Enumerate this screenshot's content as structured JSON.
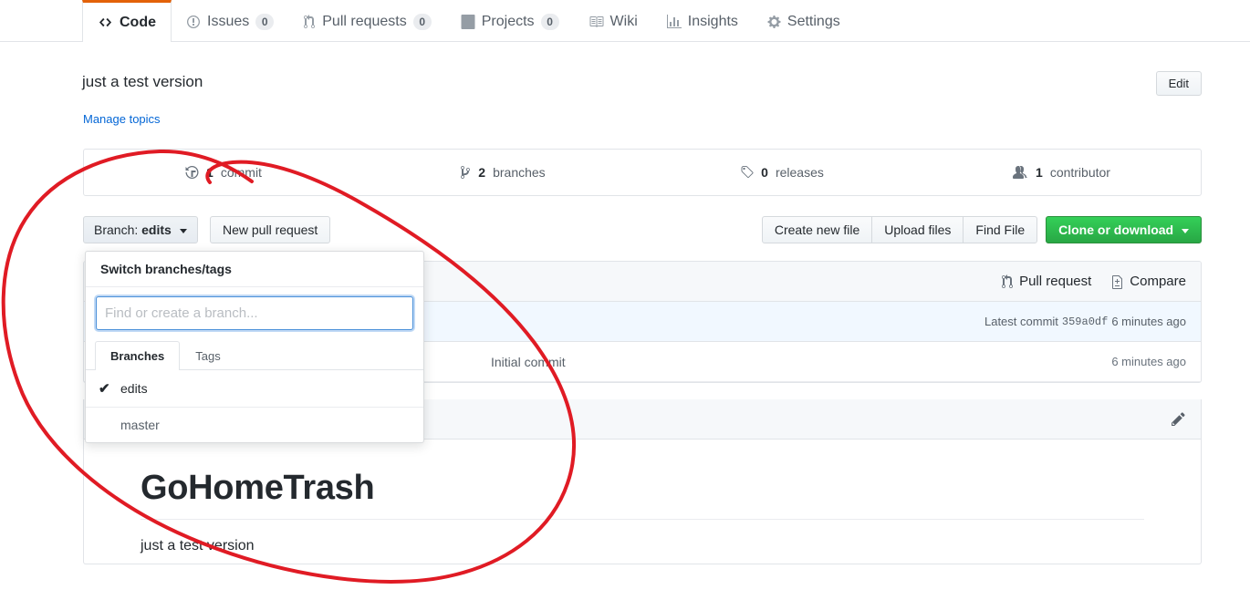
{
  "nav": {
    "tabs": [
      {
        "label": "Code",
        "icon": "code-icon",
        "count": null,
        "active": true
      },
      {
        "label": "Issues",
        "icon": "issue-opened-icon",
        "count": "0",
        "active": false
      },
      {
        "label": "Pull requests",
        "icon": "git-pull-request-icon",
        "count": "0",
        "active": false
      },
      {
        "label": "Projects",
        "icon": "project-board-icon",
        "count": "0",
        "active": false
      },
      {
        "label": "Wiki",
        "icon": "book-icon",
        "count": null,
        "active": false
      },
      {
        "label": "Insights",
        "icon": "graph-icon",
        "count": null,
        "active": false
      },
      {
        "label": "Settings",
        "icon": "gear-icon",
        "count": null,
        "active": false
      }
    ]
  },
  "repo": {
    "description": "just a test version",
    "manage_topics_label": "Manage topics",
    "edit_label": "Edit"
  },
  "stats": [
    {
      "num": "1",
      "label": "commit",
      "icon": "history-icon"
    },
    {
      "num": "2",
      "label": "branches",
      "icon": "git-branch-icon"
    },
    {
      "num": "0",
      "label": "releases",
      "icon": "tag-icon"
    },
    {
      "num": "1",
      "label": "contributor",
      "icon": "people-icon"
    }
  ],
  "actions": {
    "branch_prefix": "Branch:",
    "branch_current": "edits",
    "new_pull_request": "New pull request",
    "create_new_file": "Create new file",
    "upload_files": "Upload files",
    "find_file": "Find File",
    "clone_or_download": "Clone or download"
  },
  "commit_box": {
    "pull_request_label": "Pull request",
    "compare_label": "Compare",
    "latest_prefix": "Latest commit",
    "latest_sha": "359a0df",
    "latest_time": "6 minutes ago",
    "rows": [
      {
        "name": "",
        "message": "Initial commit",
        "time": "6 minutes ago"
      }
    ]
  },
  "readme": {
    "header_label": "",
    "title": "GoHomeTrash",
    "body": "just a test version",
    "edit_icon": "pencil-icon"
  },
  "dropdown": {
    "title": "Switch branches/tags",
    "search_placeholder": "Find or create a branch...",
    "search_value": "",
    "tabs": [
      {
        "label": "Branches",
        "active": true
      },
      {
        "label": "Tags",
        "active": false
      }
    ],
    "items": [
      {
        "name": "edits",
        "selected": true
      },
      {
        "name": "master",
        "selected": false
      }
    ]
  },
  "annotation": {
    "color": "#e01b24",
    "shape": "hand-drawn-loop"
  },
  "colors": {
    "accent_orange": "#e36209",
    "link_blue": "#0366d6",
    "green_button": "#28a745",
    "border_gray": "#e1e4e8",
    "annotation_red": "#e01b24"
  }
}
